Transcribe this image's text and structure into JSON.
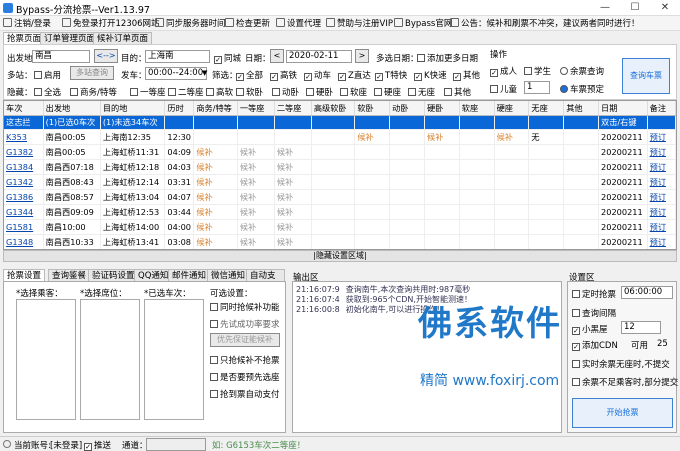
{
  "window": {
    "title": "Bypass-分流抢票--Ver1.13.97",
    "min": "—",
    "max": "☐",
    "close": "✕"
  },
  "menu": [
    "注销/登录",
    "免登录打开12306网站",
    "同步服务器时间",
    "检查更新",
    "设置代理",
    "赞助与注册VIP",
    "Bypass官网",
    "公告：候补和刷票不冲突，建议两者同时进行！"
  ],
  "tabs": [
    "抢票页面",
    "订单管理页面",
    "候补订单页面"
  ],
  "form": {
    "from_label": "出发地：",
    "from": "南昌",
    "swap": "<-->",
    "to_label": "目的：",
    "to": "上海南",
    "same_city": "同城",
    "date_label": "日期：",
    "prev": "<",
    "date": "2020-02-11",
    "next": ">",
    "multi_label": "多选日期：",
    "add_multi": "添加更多日期",
    "multi_station_label": "多站：",
    "enable": "启用",
    "multi_station_btn": "多站查询",
    "depart_label": "发车：",
    "time_range": "00:00--24:00",
    "filter_label": "筛选：",
    "filters": [
      "全部",
      "高铁",
      "动车",
      "Z直达",
      "T特快",
      "K快速",
      "其他"
    ],
    "hide_label": "隐藏：",
    "hide_items": [
      "全选",
      "商务/特等",
      "一等座",
      "二等座",
      "高软",
      "软卧",
      "动卧",
      "硬卧",
      "软座",
      "硬座",
      "无座",
      "其他"
    ],
    "ops_label": "操作",
    "adult": "成人",
    "student": "学生",
    "child": "儿童",
    "child_count": "1",
    "remaining": "余票查询",
    "booking": "车票预定",
    "query_btn": "查询车票"
  },
  "table": {
    "headers": [
      "车次",
      "出发地",
      "目的地",
      "历时",
      "商务/特等",
      "一等座",
      "二等座",
      "高级软卧",
      "软卧",
      "动卧",
      "硬卧",
      "软座",
      "硬座",
      "无座",
      "其他",
      "日期",
      "备注"
    ],
    "rows": [
      [
        "这志拦",
        "(1)已选0车次",
        "(1)未选34车次",
        "",
        "",
        "",
        "",
        "",
        "",
        "",
        "",
        "",
        "",
        "",
        "",
        "双击/右键",
        ""
      ],
      [
        "K353",
        "南昌00:05",
        "上海南12:35",
        "12:30",
        "",
        "",
        "",
        "",
        "候补",
        "",
        "候补",
        "",
        "候补",
        "无",
        "",
        "20200211",
        "预订"
      ],
      [
        "G1382",
        "南昌00:05",
        "上海虹桥11:31",
        "04:09",
        "候补",
        "候补",
        "候补",
        "",
        "",
        "",
        "",
        "",
        "",
        "",
        "",
        "20200211",
        "预订"
      ],
      [
        "G1384",
        "南昌西07:18",
        "上海虹桥12:18",
        "04:03",
        "候补",
        "候补",
        "候补",
        "",
        "",
        "",
        "",
        "",
        "",
        "",
        "",
        "20200211",
        "预订"
      ],
      [
        "G1342",
        "南昌西08:43",
        "上海虹桥12:14",
        "03:31",
        "候补",
        "候补",
        "候补",
        "",
        "",
        "",
        "",
        "",
        "",
        "",
        "",
        "20200211",
        "预订"
      ],
      [
        "G1386",
        "南昌西08:57",
        "上海虹桥13:04",
        "04:07",
        "候补",
        "候补",
        "候补",
        "",
        "",
        "",
        "",
        "",
        "",
        "",
        "",
        "20200211",
        "预订"
      ],
      [
        "G1344",
        "南昌西09:09",
        "上海虹桥12:53",
        "03:44",
        "候补",
        "候补",
        "候补",
        "",
        "",
        "",
        "",
        "",
        "",
        "",
        "",
        "20200211",
        "预订"
      ],
      [
        "G1581",
        "南昌10:00",
        "上海虹桥14:00",
        "04:00",
        "候补",
        "候补",
        "候补",
        "",
        "",
        "",
        "",
        "",
        "",
        "",
        "",
        "20200211",
        "预订"
      ],
      [
        "G1348",
        "南昌西10:33",
        "上海虹桥13:41",
        "03:08",
        "候补",
        "候补",
        "候补",
        "",
        "",
        "",
        "",
        "",
        "",
        "",
        "",
        "20200211",
        "预订"
      ]
    ]
  },
  "hide_bar": "|隐藏设置区域|",
  "settings_tabs": [
    "抢票设置",
    "查询鉴餐",
    "验证码设置",
    "QQ通知",
    "邮件通知",
    "微信通知",
    "自动支付"
  ],
  "passenger_label": "*选择乘客：",
  "seat_label": "*选择席位：",
  "train_label": "*已选车次：",
  "options_title": "可选设置：",
  "options": [
    "同时抢候补功能",
    "先试成功率要求",
    "优先保证能候补",
    "只抢候补不抢票",
    "是否要预先选座",
    "抢到票自动支付"
  ],
  "output_title": "输出区",
  "logs": [
    {
      "time": "21:16:07:9",
      "text": "查询南牛,本次查询共用时:987毫秒"
    },
    {
      "time": "21:16:07:4",
      "text": "获取到:965个CDN,开始智能测速！"
    },
    {
      "time": "21:16:00:8",
      "text": "初始化南牛,可以进行操作！"
    }
  ],
  "right_title": "设置区",
  "right": {
    "timer": "定时抢票",
    "timer_val": "06:00:00",
    "interval": "查询间隔",
    "vip": "小黑屋",
    "vip_val": "12",
    "cdn": "添加CDN",
    "cdn_suffix": "可用",
    "cdn_val": "25",
    "opt1": "实时余票无座时,不提交",
    "opt2": "余票不足乘客时,部分提交",
    "start_btn": "开始抢票"
  },
  "status": {
    "account_label": "当前账号:",
    "account": "[未登录]",
    "push": "推送",
    "notice_label": "通道：",
    "scroll_text": "如: G6153车次二等座！"
  },
  "watermark": {
    "big": "佛系软件",
    "small": "精简  www.foxirj.com"
  }
}
